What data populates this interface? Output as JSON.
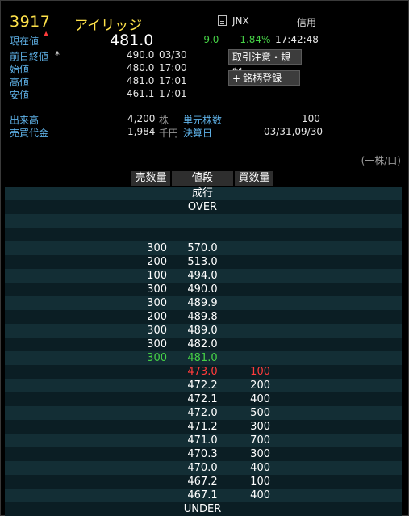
{
  "header": {
    "code": "3917",
    "name": "アイリッジ",
    "market": "JNX",
    "credit": "信用",
    "current_label": "現在値",
    "current_price": "481.0",
    "change": "-9.0",
    "change_pct": "-1.84%",
    "time": "17:42:48"
  },
  "prices": [
    {
      "label": "前日終値",
      "mark": "*",
      "value": "490.0",
      "time": "03/30"
    },
    {
      "label": "始値",
      "mark": "",
      "value": "480.0",
      "time": "17:00"
    },
    {
      "label": "高値",
      "mark": "",
      "value": "481.0",
      "time": "17:01"
    },
    {
      "label": "安値",
      "mark": "",
      "value": "461.1",
      "time": "17:01"
    }
  ],
  "buttons": {
    "regulation": "取引注意・規制",
    "add_watch": "銘柄登録"
  },
  "stats": {
    "volume_label": "出来高",
    "volume": "4,200",
    "volume_unit": "株",
    "unit_shares_label": "単元株数",
    "unit_shares": "100",
    "turnover_label": "売買代金",
    "turnover": "1,984",
    "turnover_unit": "千円",
    "settlement_label": "決算日",
    "settlement": "03/31,09/30"
  },
  "unit_note": "(一株/口)",
  "board": {
    "headers": {
      "sell": "売数量",
      "price": "値段",
      "buy": "買数量"
    },
    "rows": [
      {
        "sell": "",
        "price": "成行",
        "buy": ""
      },
      {
        "sell": "",
        "price": "OVER",
        "buy": ""
      },
      {
        "sell": "",
        "price": "",
        "buy": ""
      },
      {
        "sell": "",
        "price": "",
        "buy": ""
      },
      {
        "sell": "300",
        "price": "570.0",
        "buy": ""
      },
      {
        "sell": "200",
        "price": "513.0",
        "buy": ""
      },
      {
        "sell": "100",
        "price": "494.0",
        "buy": ""
      },
      {
        "sell": "300",
        "price": "490.0",
        "buy": ""
      },
      {
        "sell": "300",
        "price": "489.9",
        "buy": ""
      },
      {
        "sell": "200",
        "price": "489.8",
        "buy": ""
      },
      {
        "sell": "300",
        "price": "489.0",
        "buy": ""
      },
      {
        "sell": "300",
        "price": "482.0",
        "buy": ""
      },
      {
        "sell": "300",
        "price": "481.0",
        "buy": "",
        "style": "green"
      },
      {
        "sell": "",
        "price": "473.0",
        "buy": "100",
        "style": "red"
      },
      {
        "sell": "",
        "price": "472.2",
        "buy": "200"
      },
      {
        "sell": "",
        "price": "472.1",
        "buy": "400"
      },
      {
        "sell": "",
        "price": "472.0",
        "buy": "500"
      },
      {
        "sell": "",
        "price": "471.2",
        "buy": "300"
      },
      {
        "sell": "",
        "price": "471.0",
        "buy": "700"
      },
      {
        "sell": "",
        "price": "470.3",
        "buy": "300"
      },
      {
        "sell": "",
        "price": "470.0",
        "buy": "400"
      },
      {
        "sell": "",
        "price": "467.2",
        "buy": "100"
      },
      {
        "sell": "",
        "price": "467.1",
        "buy": "400"
      },
      {
        "sell": "",
        "price": "UNDER",
        "buy": ""
      }
    ]
  },
  "colors": {
    "accent": "#ffe24a",
    "label": "#5fb2e8",
    "down": "#46d246",
    "up": "#ff3b3b",
    "board_bg": "#0c2025"
  }
}
